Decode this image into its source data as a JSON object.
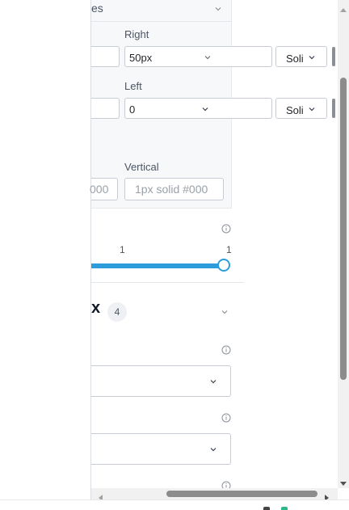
{
  "section_header": {
    "title_fragment": "es"
  },
  "border_style": {
    "right": {
      "label": "Right",
      "value": "50px",
      "style_value": "Soli"
    },
    "left": {
      "label": "Left",
      "value": "0",
      "style_value": "Soli"
    },
    "horizontal": {
      "value_fragment": "000"
    },
    "vertical": {
      "label": "Vertical",
      "placeholder": "1px solid #000"
    }
  },
  "slider": {
    "min_label": "1",
    "max_label": "1",
    "value_fraction": 1.0
  },
  "flex_section": {
    "title_fragment": "x",
    "badge_count": "4"
  },
  "colors": {
    "accent": "#2d9cdb",
    "text": "#1f2328",
    "muted": "#9aa1a9"
  },
  "icons": {
    "chevron": "chevron-down-icon",
    "info": "info-icon",
    "scroll_up": "arrow-up-icon",
    "scroll_down": "arrow-down-icon",
    "scroll_left": "arrow-left-icon",
    "scroll_right": "arrow-right-icon"
  }
}
